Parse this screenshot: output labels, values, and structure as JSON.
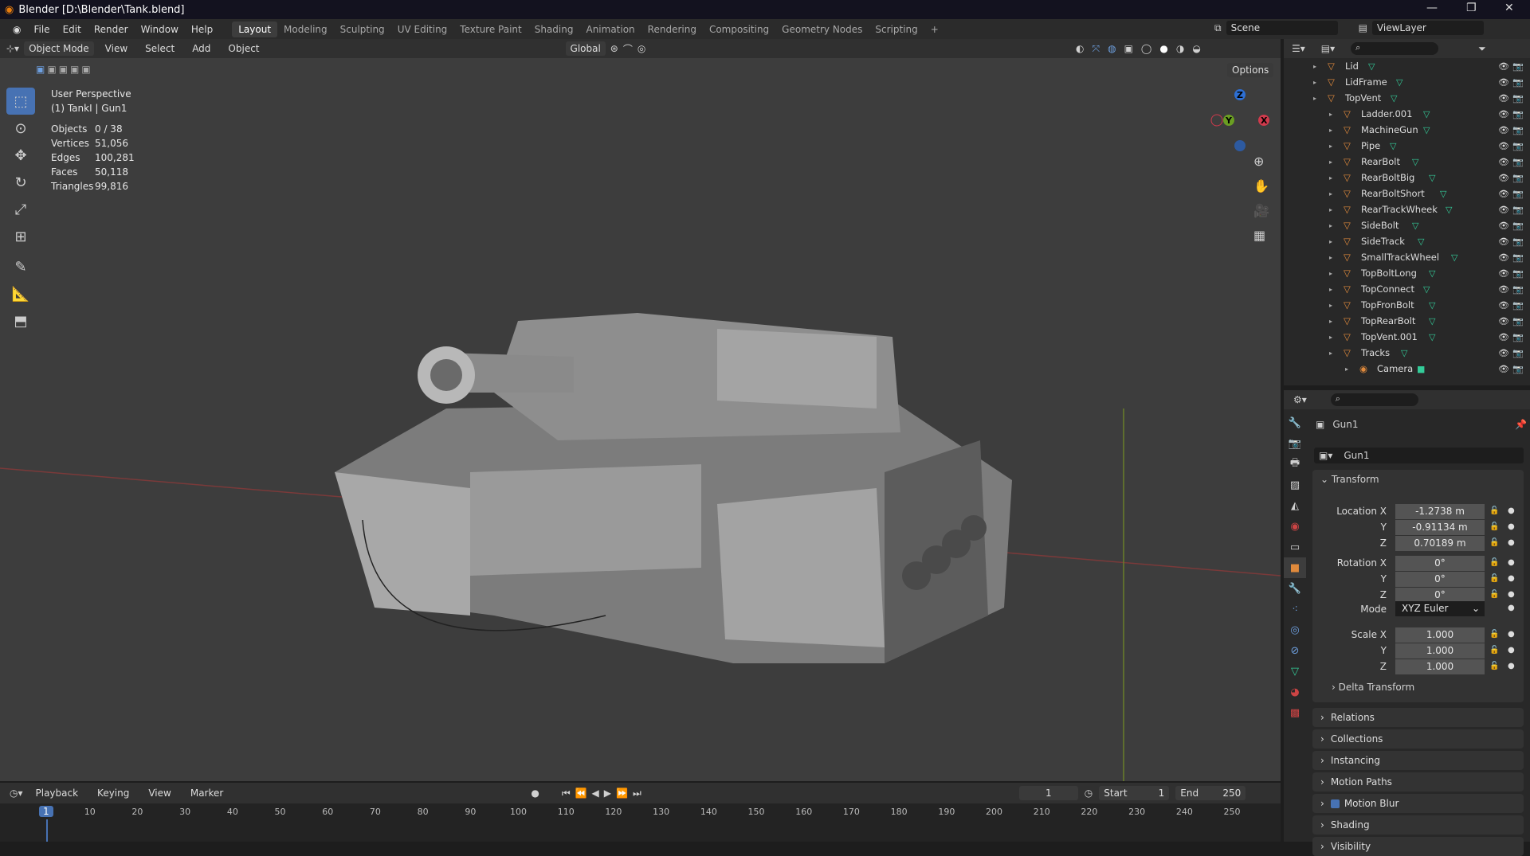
{
  "title": "Blender [D:\\Blender\\Tank.blend]",
  "menu": [
    "File",
    "Edit",
    "Render",
    "Window",
    "Help"
  ],
  "workspaces": [
    "Layout",
    "Modeling",
    "Sculpting",
    "UV Editing",
    "Texture Paint",
    "Shading",
    "Animation",
    "Rendering",
    "Compositing",
    "Geometry Nodes",
    "Scripting",
    "+"
  ],
  "scene": "Scene",
  "view_layer": "ViewLayer",
  "viewport_header": {
    "mode": "Object Mode",
    "view": "View",
    "select": "Select",
    "add": "Add",
    "object": "Object",
    "orientation": "Global",
    "options": "Options"
  },
  "overlay": {
    "perspective": "User Perspective",
    "context": "(1) TankI | Gun1"
  },
  "stats": [
    {
      "k": "Objects",
      "v": "0 / 38"
    },
    {
      "k": "Vertices",
      "v": "51,056"
    },
    {
      "k": "Edges",
      "v": "100,281"
    },
    {
      "k": "Faces",
      "v": "50,118"
    },
    {
      "k": "Triangles",
      "v": "99,816"
    }
  ],
  "gizmo": {
    "z": "Z",
    "y": "Y",
    "x": "X"
  },
  "outliner": [
    {
      "name": "Lid",
      "level": 2
    },
    {
      "name": "LidFrame",
      "level": 2
    },
    {
      "name": "TopVent",
      "level": 2
    },
    {
      "name": "Ladder.001",
      "level": 1
    },
    {
      "name": "MachineGun",
      "level": 1
    },
    {
      "name": "Pipe",
      "level": 1
    },
    {
      "name": "RearBolt",
      "level": 1
    },
    {
      "name": "RearBoltBig",
      "level": 1
    },
    {
      "name": "RearBoltShort",
      "level": 1
    },
    {
      "name": "RearTrackWheek",
      "level": 1
    },
    {
      "name": "SideBolt",
      "level": 1
    },
    {
      "name": "SideTrack",
      "level": 1
    },
    {
      "name": "SmallTrackWheel",
      "level": 1
    },
    {
      "name": "TopBoltLong",
      "level": 1
    },
    {
      "name": "TopConnect",
      "level": 1
    },
    {
      "name": "TopFronBolt",
      "level": 1
    },
    {
      "name": "TopRearBolt",
      "level": 1
    },
    {
      "name": "TopVent.001",
      "level": 1
    },
    {
      "name": "Tracks",
      "level": 1
    },
    {
      "name": "Camera",
      "level": 0
    }
  ],
  "properties": {
    "object_name": "Gun1",
    "data_name": "Gun1",
    "transform": "Transform",
    "location": {
      "label": "Location X",
      "x": "-1.2738 m",
      "y": "-0.91134 m",
      "z": "0.70189 m"
    },
    "rotation": {
      "label": "Rotation X",
      "x": "0°",
      "y": "0°",
      "z": "0°"
    },
    "mode_label": "Mode",
    "mode": "XYZ Euler",
    "scale": {
      "label": "Scale X",
      "x": "1.000",
      "y": "1.000",
      "z": "1.000"
    },
    "axis": {
      "y": "Y",
      "z": "Z"
    },
    "delta": "Delta Transform",
    "panels": [
      "Relations",
      "Collections",
      "Instancing",
      "Motion Paths",
      "Motion Blur",
      "Shading",
      "Visibility"
    ]
  },
  "timeline": {
    "playback": "Playback",
    "keying": "Keying",
    "view": "View",
    "marker": "Marker",
    "current": "1",
    "start_label": "Start",
    "start": "1",
    "end_label": "End",
    "end": "250",
    "ticks": [
      "10",
      "20",
      "30",
      "40",
      "50",
      "60",
      "70",
      "80",
      "90",
      "100",
      "110",
      "120",
      "130",
      "140",
      "150",
      "160",
      "170",
      "180",
      "190",
      "200",
      "210",
      "220",
      "230",
      "240",
      "250"
    ]
  },
  "colors": {
    "accent": "#4772b3",
    "frame": "#4772b3",
    "orange": "#e08a3c"
  }
}
